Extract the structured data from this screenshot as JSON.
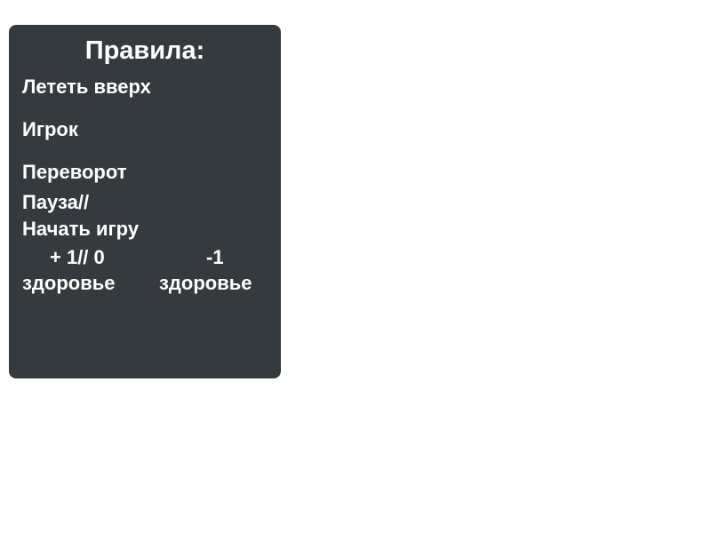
{
  "rules": {
    "title": "Правила:",
    "fly_up": "Лететь вверх",
    "player": "Игрок",
    "flip": "Переворот",
    "pause": "Пауза//",
    "start": "Начать игру",
    "health_plus": {
      "value": "+ 1// 0",
      "label": "здоровье"
    },
    "health_minus": {
      "value": "-1",
      "label": "здоровье"
    }
  },
  "colors": {
    "panel_background": "#343a3d",
    "text": "#ffffff",
    "page_background": "#ffffff"
  }
}
